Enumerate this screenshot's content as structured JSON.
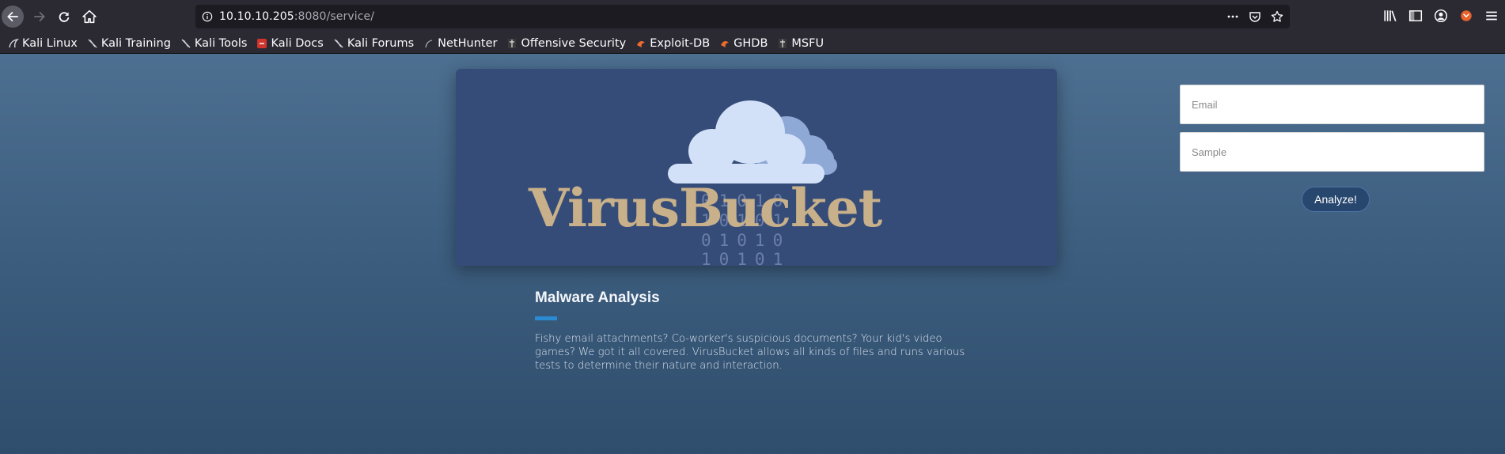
{
  "browser": {
    "url_host": "10.10.10.205",
    "url_rest": ":8080/service/",
    "bookmarks": [
      {
        "label": "Kali Linux",
        "icon": "kali-dragon-icon"
      },
      {
        "label": "Kali Training",
        "icon": "kali-dragon-icon"
      },
      {
        "label": "Kali Tools",
        "icon": "kali-dragon-icon"
      },
      {
        "label": "Kali Docs",
        "icon": "kali-docs-icon"
      },
      {
        "label": "Kali Forums",
        "icon": "kali-dragon-icon"
      },
      {
        "label": "NetHunter",
        "icon": "nethunter-icon"
      },
      {
        "label": "Offensive Security",
        "icon": "offsec-icon"
      },
      {
        "label": "Exploit-DB",
        "icon": "exploitdb-icon"
      },
      {
        "label": "GHDB",
        "icon": "ghdb-icon"
      },
      {
        "label": "MSFU",
        "icon": "msfu-icon"
      }
    ]
  },
  "hero": {
    "brand": "VirusBucket",
    "binary_rows": [
      "01010",
      "10101",
      "01010",
      "10101"
    ]
  },
  "section": {
    "title": "Malware Analysis",
    "body": "Fishy email attachments? Co-worker's suspicious documents? Your kid's video games? We got it all covered. VirusBucket allows all kinds of files and runs various tests to determine their nature and interaction."
  },
  "form": {
    "email_placeholder": "Email",
    "sample_placeholder": "Sample",
    "submit_label": "Analyze!"
  },
  "colors": {
    "accent": "#2a8bd3",
    "brand_gold": "#c8b08a",
    "hero_bg": "#364c78",
    "button_bg": "#27476f"
  }
}
